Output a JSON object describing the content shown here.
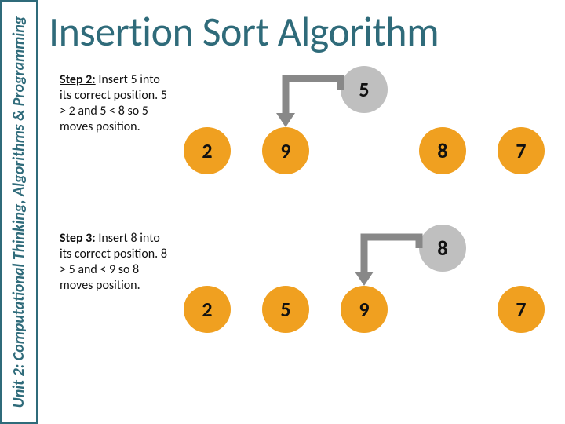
{
  "sidebar": {
    "label": "Unit 2: Computational Thinking, Algorithms & Programming"
  },
  "title": "Insertion Sort Algorithm",
  "steps": [
    {
      "label": "Step 2:",
      "desc": " Insert 5 into its correct position. 5 > 2 and 5 < 8 so 5 moves position.",
      "row": [
        "2",
        "9",
        "",
        "8",
        "7"
      ],
      "floating": {
        "value": "5",
        "slot_index": 2
      },
      "arrow_from_slot": 2,
      "arrow_to_slot": 1
    },
    {
      "label": "Step 3:",
      "desc": " Insert 8 into its correct position. 8 > 5 and < 9 so 8 moves position.",
      "row": [
        "2",
        "5",
        "9",
        "",
        "7"
      ],
      "floating": {
        "value": "8",
        "slot_index": 3
      },
      "arrow_from_slot": 3,
      "arrow_to_slot": 2
    }
  ],
  "colors": {
    "accent": "#2f6b7a",
    "bubble": "#f0a020",
    "floating": "#bfbfbf",
    "arrow": "#888888"
  },
  "chart_data": {
    "type": "diagram",
    "algorithm": "insertion_sort",
    "steps": [
      {
        "step": 2,
        "sorted_prefix": [
          2
        ],
        "moving": 5,
        "compared_with": [
          2,
          8
        ],
        "array_visible": [
          2,
          9,
          null,
          8,
          7
        ]
      },
      {
        "step": 3,
        "sorted_prefix": [
          2,
          5
        ],
        "moving": 8,
        "compared_with": [
          5,
          9
        ],
        "array_visible": [
          2,
          5,
          9,
          null,
          7
        ]
      }
    ]
  }
}
